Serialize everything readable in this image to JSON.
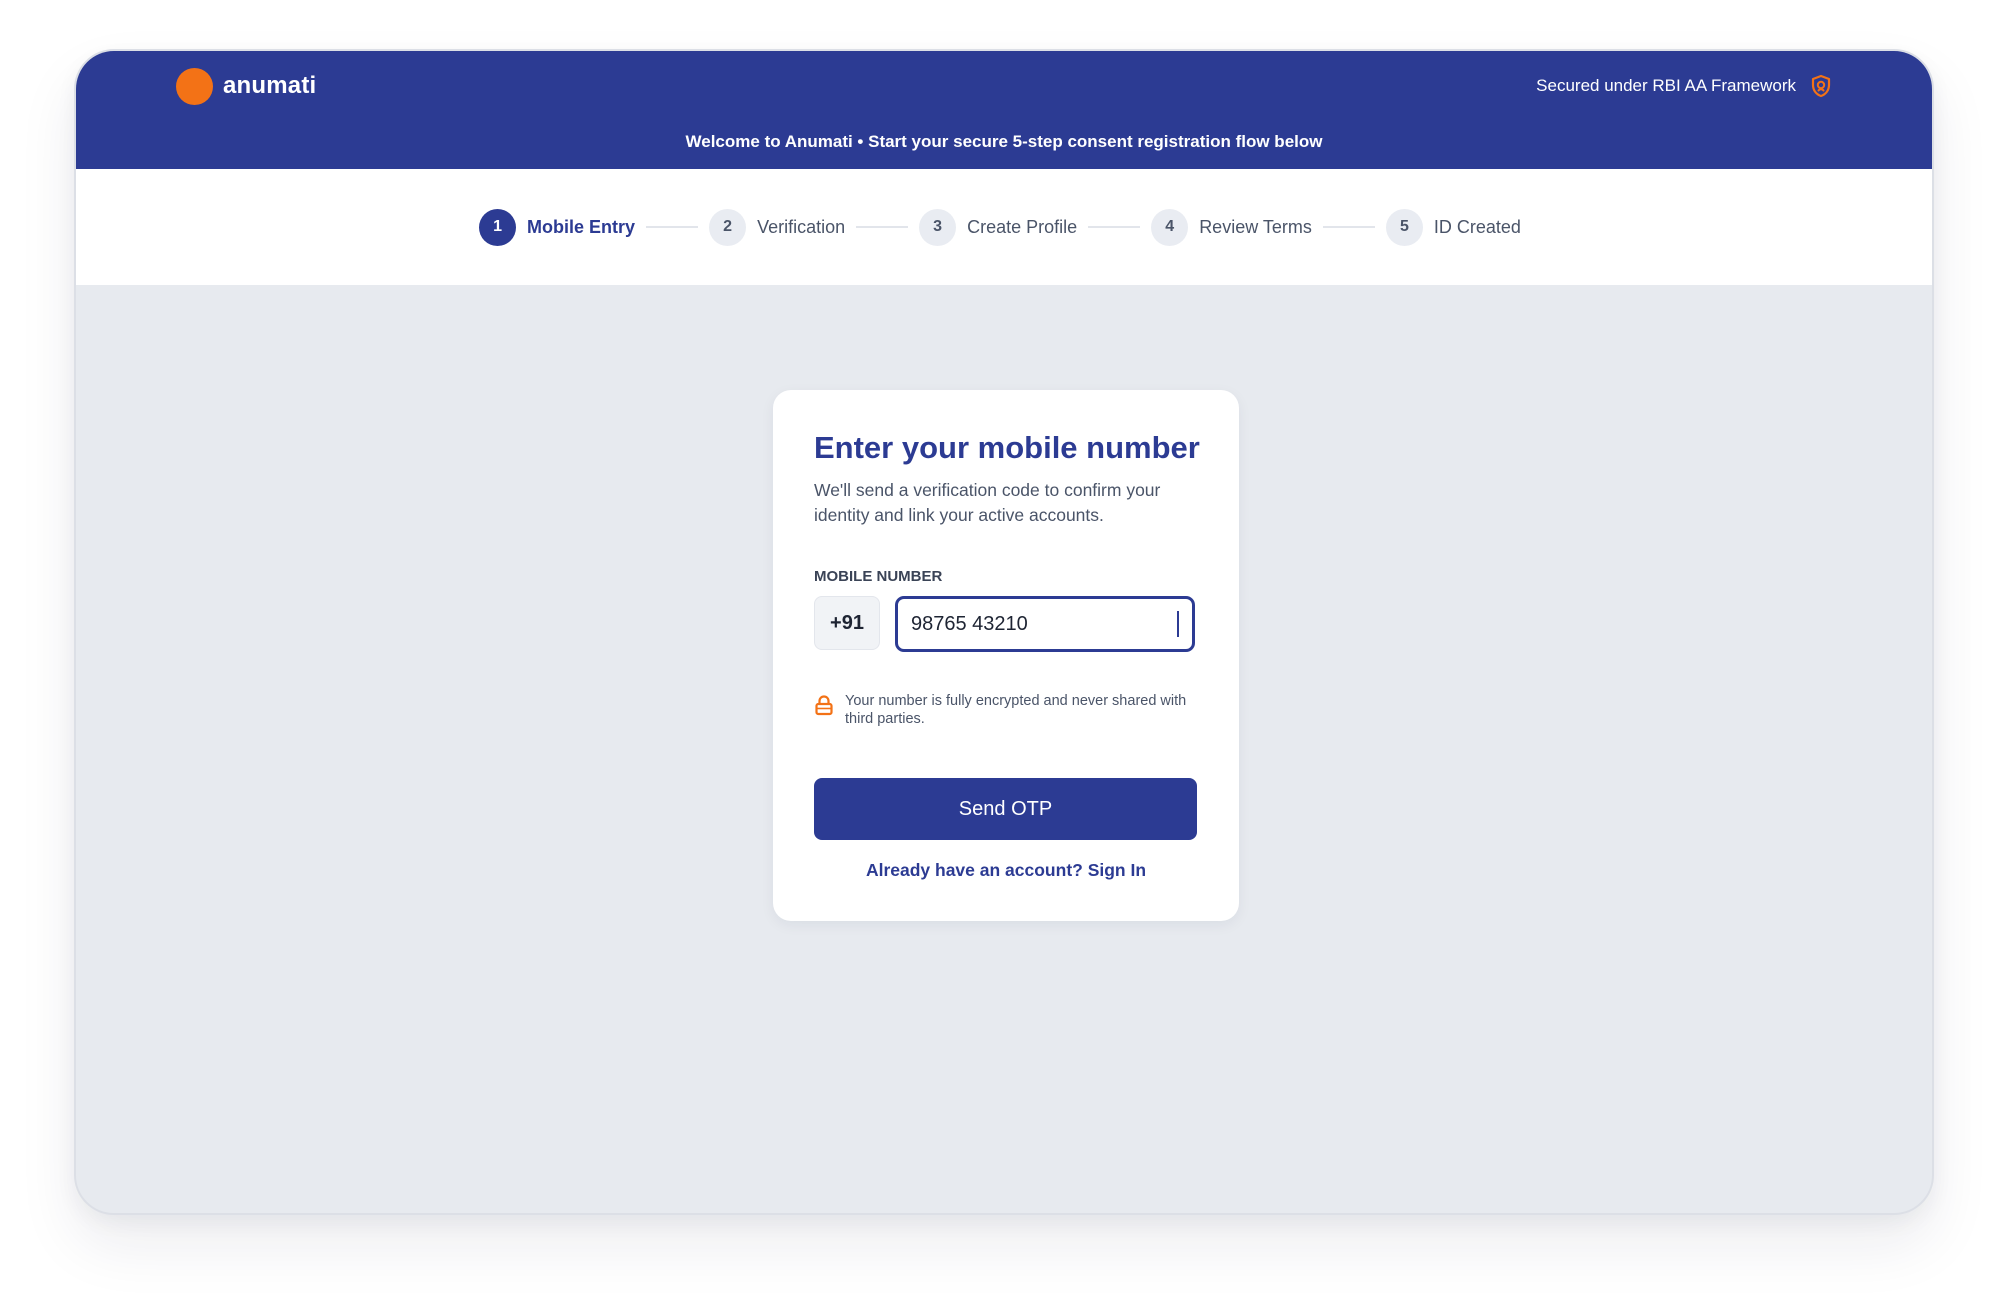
{
  "colors": {
    "primary": "#2c3b93",
    "accent": "#f37216",
    "background": "#e7eaef"
  },
  "header": {
    "brand_name": "anumati",
    "brand_icon": "orange-circle-logo",
    "secure_text": "Secured under RBI AA Framework",
    "secure_icon": "shield-icon",
    "welcome_text": "Welcome to Anumati • Start your secure 5-step consent registration flow below"
  },
  "stepper": {
    "active_step": 1,
    "steps": [
      {
        "number": "1",
        "label": "Mobile Entry"
      },
      {
        "number": "2",
        "label": "Verification"
      },
      {
        "number": "3",
        "label": "Create Profile"
      },
      {
        "number": "4",
        "label": "Review Terms"
      },
      {
        "number": "5",
        "label": "ID Created"
      }
    ]
  },
  "card": {
    "title": "Enter your mobile number",
    "subtitle": "We'll send a verification code to confirm your identity and link your active accounts.",
    "field_label": "MOBILE NUMBER",
    "country_code": "+91",
    "mobile_value": "98765 43210",
    "note_icon": "lock-icon",
    "note_text": "Your number is fully encrypted and never shared with third parties.",
    "send_button": "Send OTP",
    "signin_link": "Already have an account? Sign In"
  }
}
